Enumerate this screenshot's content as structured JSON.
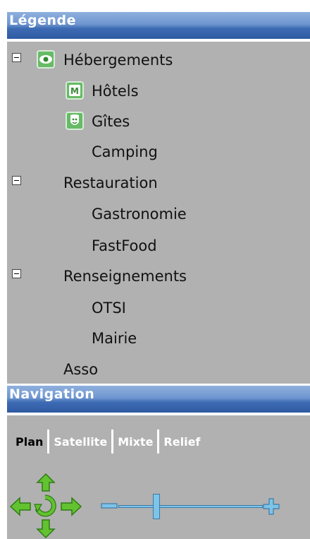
{
  "legend": {
    "title": "Légende",
    "items": [
      {
        "label": "Hébergements",
        "level": 0,
        "collapsible": true,
        "icon": "eye-icon"
      },
      {
        "label": "Hôtels",
        "level": 1,
        "icon": "hotel-icon"
      },
      {
        "label": "Gîtes",
        "level": 1,
        "icon": "gite-icon"
      },
      {
        "label": "Camping",
        "level": 1
      },
      {
        "label": "Restauration",
        "level": 0,
        "collapsible": true
      },
      {
        "label": "Gastronomie",
        "level": 1
      },
      {
        "label": "FastFood",
        "level": 1
      },
      {
        "label": "Renseignements",
        "level": 0,
        "collapsible": true
      },
      {
        "label": "OTSI",
        "level": 1
      },
      {
        "label": "Mairie",
        "level": 1
      },
      {
        "label": "Asso",
        "level": 0
      }
    ]
  },
  "navigation": {
    "title": "Navigation",
    "map_types": [
      "Plan",
      "Satellite",
      "Mixte",
      "Relief"
    ],
    "selected_map_type": "Plan",
    "zoom_level_fraction": 0.25
  },
  "colors": {
    "header_blue": "#3d6bb3",
    "panel_gray": "#b1b1b1",
    "control_green": "#5cb82a"
  }
}
